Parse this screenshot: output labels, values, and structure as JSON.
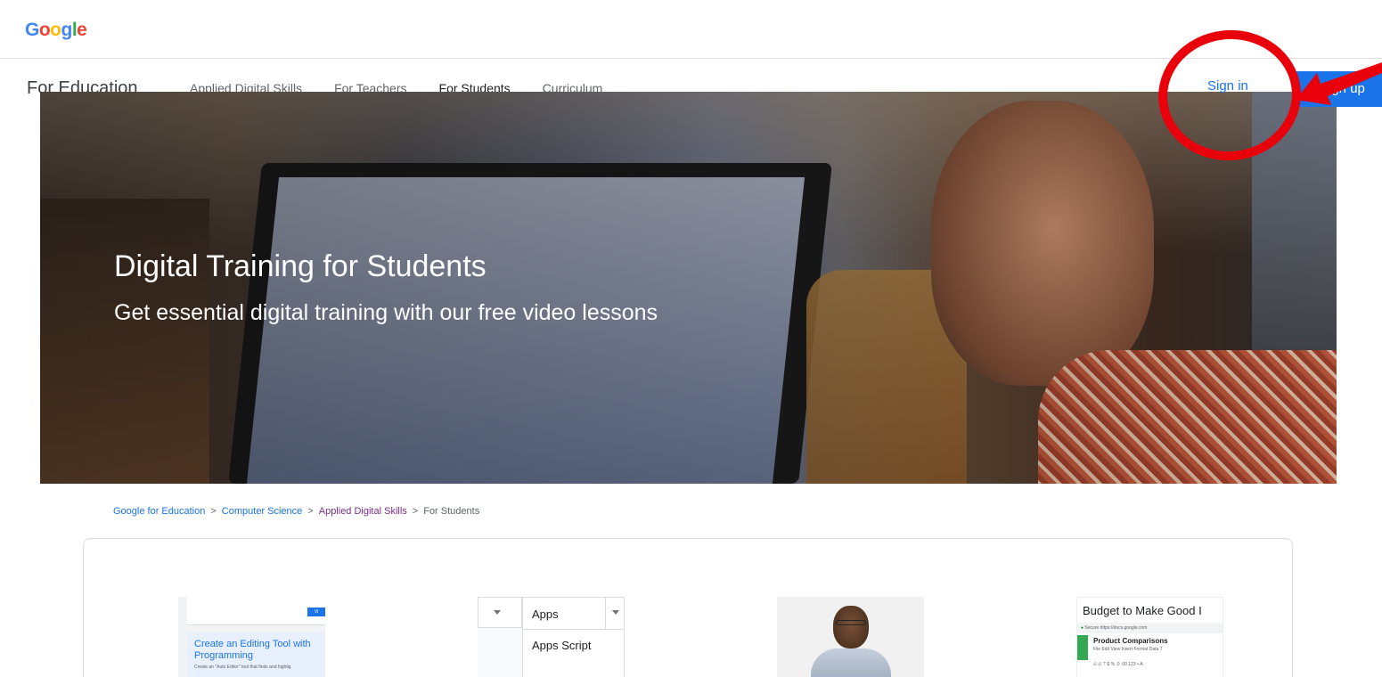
{
  "logo": {
    "letters": [
      "G",
      "o",
      "o",
      "g",
      "l",
      "e"
    ]
  },
  "nav": {
    "brand": "For Education",
    "items": [
      {
        "label": "Applied Digital Skills",
        "active": false
      },
      {
        "label": "For Teachers",
        "active": false
      },
      {
        "label": "For Students",
        "active": true
      },
      {
        "label": "Curriculum",
        "active": false
      }
    ],
    "sign_in": "Sign in",
    "sign_up": "Sign up"
  },
  "hero": {
    "title": "Digital Training for Students",
    "subtitle": "Get essential digital training with our free video lessons"
  },
  "breadcrumb": {
    "items": [
      "Google for Education",
      "Computer Science",
      "Applied Digital Skills",
      "For Students"
    ],
    "separator": ">"
  },
  "cards": {
    "editing_tool": {
      "title": "Create an Editing Tool with Programming",
      "description": "Create an \"Auto Editor\" tool that finds and highlig",
      "button": "Vi"
    },
    "apps_script": {
      "menu_top": "Apps",
      "menu_item": "Apps Script"
    },
    "budget": {
      "title": "Budget to Make Good I",
      "address": "Secure  https://docs.google.com",
      "doc_name": "Product Comparisons",
      "menu": "File  Edit  View  Insert  Format  Data  T",
      "toolbar": "⎌ ⎌ ⊤  $ % .0 .00 123 ▾  A"
    }
  },
  "colors": {
    "accent": "#1a73e8",
    "visited_link": "#7b2f8c",
    "annotation": "#e8000b"
  }
}
